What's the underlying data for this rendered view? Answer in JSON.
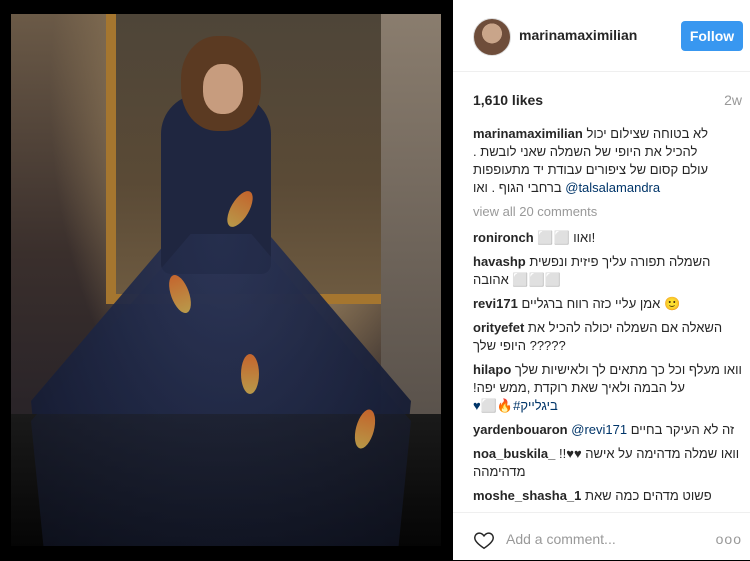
{
  "post": {
    "username": "marinamaximilian",
    "follow_label": "Follow",
    "likes": "1,610 likes",
    "age": "2w",
    "caption_lines": [
      "לא בטוחה שצילום יכול",
      "להכיל את היופי של השמלה שאני לובשת .",
      "עולם קסום של ציפורים עבודת יד מתעופפות",
      "ברחבי הגוף . ואו"
    ],
    "caption_mention": "@talsalamandra",
    "view_all": "view all 20 comments"
  },
  "comments": [
    {
      "user": "ronironch",
      "text": "!ואוו ⬜⬜"
    },
    {
      "user": "havashp",
      "text": "השמלה תפורה עליך פיזית ונפשית ⬜⬜⬜ אהובה"
    },
    {
      "user": "revi171",
      "text": "🙂 אמן עליי כזה רווח ברגליים"
    },
    {
      "user": "orityefet",
      "text": "השאלה אם השמלה יכולה להכיל את ?????‏ היופי שלך"
    },
    {
      "user": "hilapo",
      "text": "וואו מעלף וכל כך מתאים לך ולאישיות שלך על הבמה ולאיך שאת רוקדת ,ממש יפה!"
    },
    {
      "user": "",
      "text": "‎♥⬜🔥#ביגלייק"
    },
    {
      "user": "yardenbouaron",
      "mention": "@revi171",
      "text": "זה לא העיקר בחיים"
    },
    {
      "user": "noa_buskila_",
      "text": "וואו שמלה מדהימה על אישה ♥♥!!מדהימהה"
    },
    {
      "user": "moshe_shasha_1",
      "text": "פשוט מדהים כמה שאת"
    }
  ],
  "footer": {
    "add_comment_placeholder": "Add a comment...",
    "more_label": "ooo"
  }
}
